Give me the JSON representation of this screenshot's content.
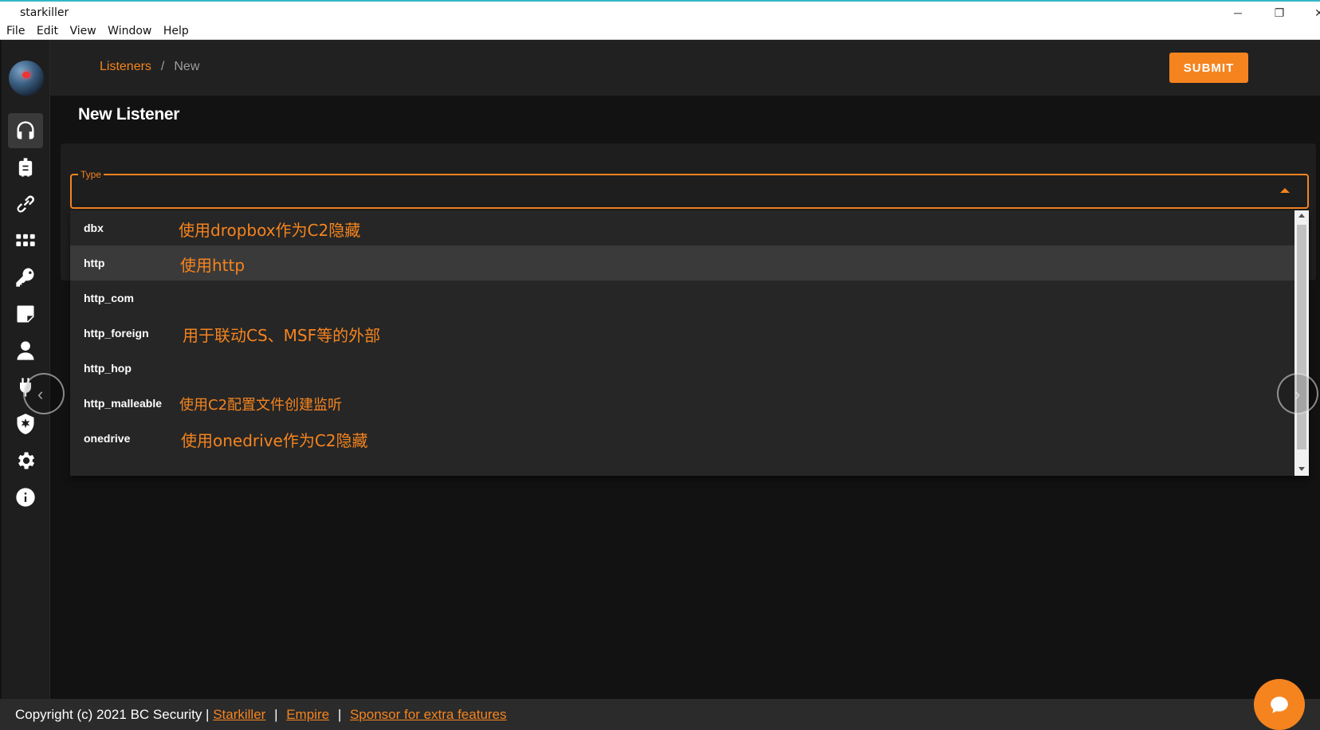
{
  "window": {
    "title": "starkiller",
    "controls": {
      "minimize": "─",
      "restore": "❐",
      "close": "✕"
    }
  },
  "menubar": [
    "File",
    "Edit",
    "View",
    "Window",
    "Help"
  ],
  "breadcrumb": {
    "root": "Listeners",
    "separator": "/",
    "current": "New"
  },
  "submit_label": "SUBMIT",
  "page_title": "New Listener",
  "type_field": {
    "label": "Type",
    "value": ""
  },
  "dropdown": {
    "items": [
      {
        "label": "dbx",
        "note": "使用dropbox作为C2隐藏"
      },
      {
        "label": "http",
        "note": "使用http",
        "highlighted": true
      },
      {
        "label": "http_com",
        "note": ""
      },
      {
        "label": "http_foreign",
        "note": "用于联动CS、MSF等的外部"
      },
      {
        "label": "http_hop",
        "note": ""
      },
      {
        "label": "http_malleable",
        "note": "使用C2配置文件创建监听"
      },
      {
        "label": "onedrive",
        "note": "使用onedrive作为C2隐藏"
      }
    ]
  },
  "sidebar_icons": [
    "headset-icon",
    "briefcase-icon",
    "link-icon",
    "apps-icon",
    "key-icon",
    "note-icon",
    "user-icon",
    "plugin-icon",
    "shield-icon",
    "settings-icon",
    "info-icon"
  ],
  "footer": {
    "copyright": "Copyright (c) 2021 BC Security |",
    "links": [
      "Starkiller",
      "Empire",
      "Sponsor for extra features"
    ],
    "separator": "|"
  },
  "overlay": {
    "prev": "‹",
    "next": "›"
  },
  "colors": {
    "accent": "#f5841f",
    "background": "#121212",
    "sidebar": "#1e1e1e"
  }
}
